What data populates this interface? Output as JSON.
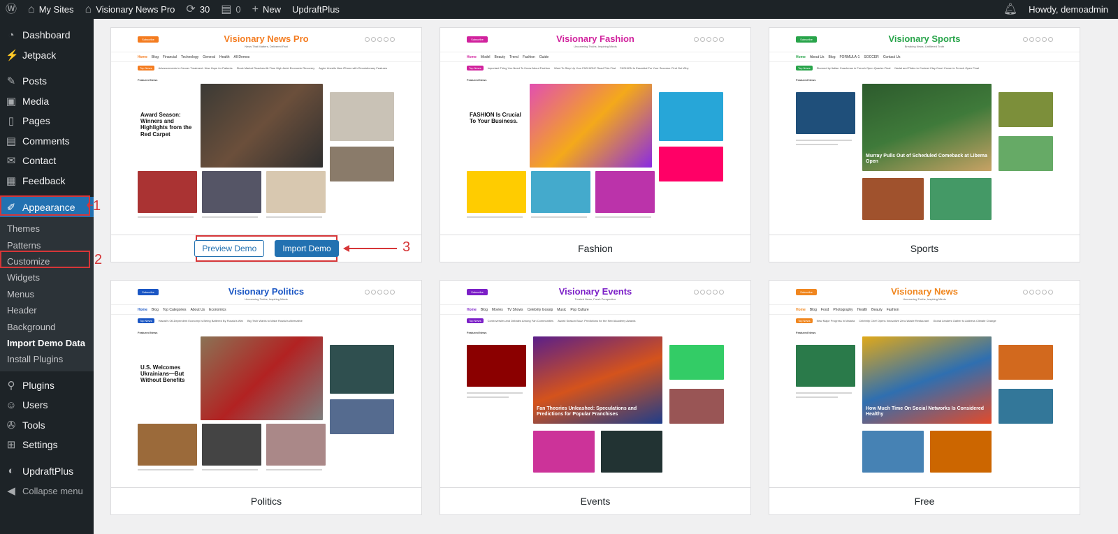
{
  "adminbar": {
    "my_sites": "My Sites",
    "site_name": "Visionary News Pro",
    "updates_count": "30",
    "comments_count": "0",
    "new_label": "New",
    "updraft": "UpdraftPlus",
    "howdy": "Howdy, demoadmin"
  },
  "sidebar": {
    "items": [
      {
        "label": "Dashboard",
        "icon": "dashboard-icon"
      },
      {
        "label": "Jetpack",
        "icon": "jetpack-icon"
      },
      {
        "label": "Posts",
        "icon": "pin-icon"
      },
      {
        "label": "Media",
        "icon": "media-icon"
      },
      {
        "label": "Pages",
        "icon": "page-icon"
      },
      {
        "label": "Comments",
        "icon": "comment-icon"
      },
      {
        "label": "Contact",
        "icon": "mail-icon"
      },
      {
        "label": "Feedback",
        "icon": "feedback-icon"
      },
      {
        "label": "Appearance",
        "icon": "brush-icon"
      }
    ],
    "submenu": [
      "Themes",
      "Patterns",
      "Customize",
      "Widgets",
      "Menus",
      "Header",
      "Background",
      "Import Demo Data",
      "Install Plugins"
    ],
    "items_bottom": [
      {
        "label": "Plugins",
        "icon": "plugin-icon"
      },
      {
        "label": "Users",
        "icon": "users-icon"
      },
      {
        "label": "Tools",
        "icon": "wrench-icon"
      },
      {
        "label": "Settings",
        "icon": "settings-icon"
      },
      {
        "label": "UpdraftPlus",
        "icon": "updraft-icon"
      },
      {
        "label": "Collapse menu",
        "icon": "collapse-icon"
      }
    ]
  },
  "annotations": {
    "n1": "1",
    "n2": "2",
    "n3": "3"
  },
  "buttons": {
    "preview": "Preview Demo",
    "import": "Import Demo"
  },
  "demos": [
    {
      "title": "Visionary News Pro",
      "label": "",
      "color": "#f47c20",
      "tagline": "News That Matters, Delivered Fast",
      "nav": [
        "Home",
        "Blog",
        "Financial",
        "Technology",
        "General",
        "Health",
        "All Demos"
      ],
      "ticker": [
        "Advancements in Cancer Treatment: New Hope for Patients",
        "Stock Market Reaches All-Time High Amid Economic Recovery",
        "Apple Unveils New iPhone with Revolutionary Features"
      ],
      "main_headline": "Award Season: Winners and Highlights from the Red Carpet",
      "section": "Featured News"
    },
    {
      "title": "Visionary Fashion",
      "label": "Fashion",
      "color": "#d1229d",
      "tagline": "Uncovering Truths, Inspiring Minds",
      "nav": [
        "Home",
        "Model",
        "Beauty",
        "Trend",
        "Fashion",
        "Guide"
      ],
      "ticker": [
        "Important Thing You Need To Know About Fashion",
        "Want To Step Up Your FASHION? Read This First",
        "FASHION Is Essential For Your Success. Find Out Why"
      ],
      "main_headline": "FASHION Is Crucial To Your Business.",
      "section": "Featured News"
    },
    {
      "title": "Visionary Sports",
      "label": "Sports",
      "color": "#28a44a",
      "tagline": "Breaking News, Unfiltered Truth",
      "nav": [
        "Home",
        "About Us",
        "Blog",
        "FORMULA-1",
        "SOCCER",
        "Contact Us"
      ],
      "ticker": [
        "Stunned by Italian Coachman in French Open Quarter-Final",
        "Nadal and Tilden to Contest Clay Court Crown in French Open Final"
      ],
      "main_headline": "Murray Pulls Out of Scheduled Comeback at Libema Open",
      "section": "Featured News"
    },
    {
      "title": "Visionary Politics",
      "label": "Politics",
      "color": "#1a56c4",
      "tagline": "Uncovering Truths, Inspiring Minds",
      "nav": [
        "Home",
        "Blog",
        "Top Categories",
        "About Us",
        "Economics"
      ],
      "ticker": [
        "Hawaii's Oil-Dependent Economy Is Being Battered By Russia's War",
        "Big Tech Wants to Make Russia's Alternative"
      ],
      "main_headline": "U.S. Welcomes Ukrainians—But Without Benefits",
      "section": "Featured News"
    },
    {
      "title": "Visionary Events",
      "label": "Events",
      "color": "#7b1fc7",
      "tagline": "Trusted News, Fresh Perspective",
      "nav": [
        "Home",
        "Blog",
        "Movies",
        "TV Shows",
        "Celebrity Gossip",
        "Music",
        "Pop Culture"
      ],
      "ticker": [
        "Controversies and Debates Among Fan Communities",
        "Award Season Buzz: Predictions for the Next Academy Awards"
      ],
      "main_headline": "Fan Theories Unleashed: Speculations and Predictions for Popular Franchises",
      "section": "Featured News"
    },
    {
      "title": "Visionary News",
      "label": "Free",
      "color": "#f0861e",
      "tagline": "Uncovering Truths, Inspiring Minds",
      "nav": [
        "Home",
        "Blog",
        "Food",
        "Photography",
        "Health",
        "Beauty",
        "Fashion"
      ],
      "ticker": [
        "New Major Progress in Malaria",
        "Celebrity Chef Opens Innovative Zero-Waste Restaurant",
        "Global Leaders Gather to Address Climate Change"
      ],
      "main_headline": "How Much Time On Social Networks Is Considered Healthy",
      "section": "Featured News"
    }
  ]
}
